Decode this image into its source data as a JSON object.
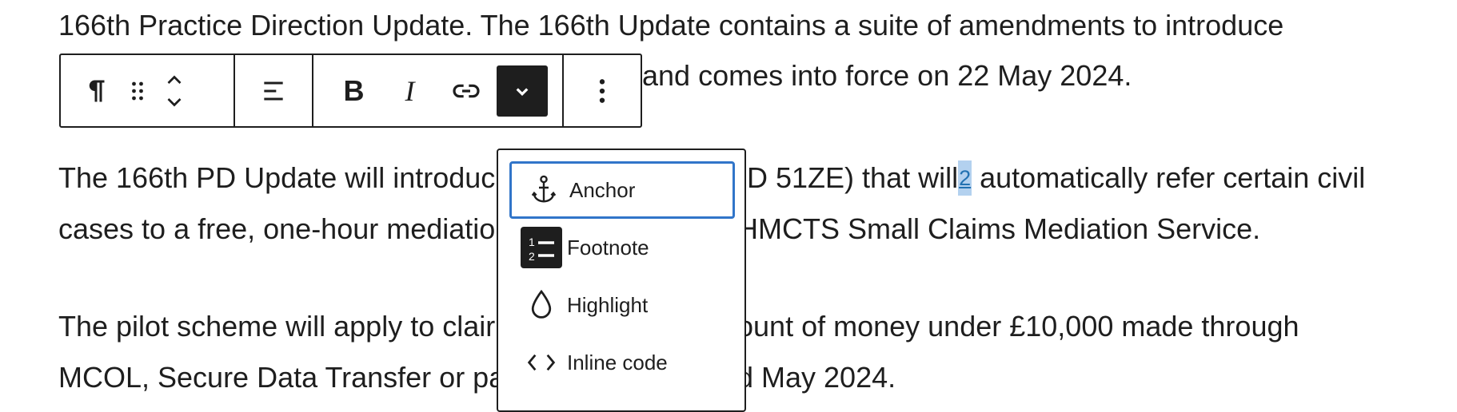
{
  "paragraphs": [
    {
      "text": "166th Practice Direction Update. The 166th Update contains a suite of amendments to introduce"
    },
    {
      "text": "and comes into force on 22 May 2024."
    },
    {
      "before": "The 166th PD Update will introduc",
      "after": "PD 51ZE) that will",
      "footnote": "2",
      "tail": " automatically refer certain civil"
    },
    {
      "before": "cases to a free, one-hour mediatio",
      "after": "HMCTS Small Claims Mediation Service."
    },
    {
      "before": "The pilot scheme will apply to clair",
      "after": "ount of money under £10,000 made through"
    },
    {
      "before": "MCOL, Secure Data Transfer or pa",
      "after": "d May 2024."
    }
  ],
  "toolbar": {
    "paragraph_icon": "pilcrow-icon",
    "drag_icon": "drag-handle-icon",
    "move_icon": "move-up-down-icon",
    "align_icon": "align-left-icon",
    "bold_label": "B",
    "italic_label": "I",
    "link_icon": "link-icon",
    "more_icon": "chevron-down-icon",
    "options_icon": "vertical-ellipsis-icon"
  },
  "format_menu": {
    "items": [
      {
        "label": "Anchor",
        "icon": "anchor-icon",
        "focused": true
      },
      {
        "label": "Footnote",
        "icon": "footnote-icon"
      },
      {
        "label": "Highlight",
        "icon": "drop-icon"
      },
      {
        "label": "Inline code",
        "icon": "code-icon"
      }
    ]
  },
  "colors": {
    "text": "#1e1e1e",
    "focus": "#3175c9",
    "selection": "#b3d1ef",
    "link": "#2271b1"
  }
}
